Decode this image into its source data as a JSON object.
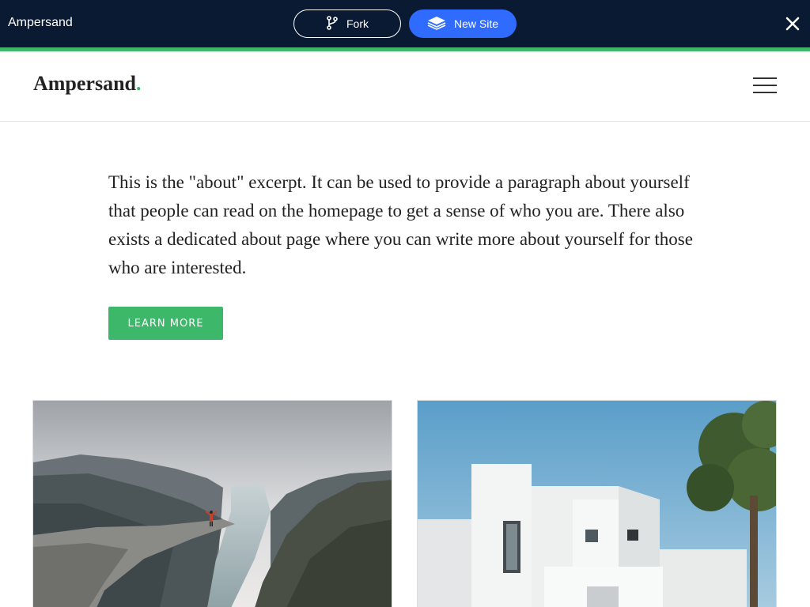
{
  "topbar": {
    "brand": "Ampersand",
    "fork_label": "Fork",
    "new_site_label": "New Site",
    "colors": {
      "background": "#0b1a33",
      "accent": "#3db86a",
      "primary": "#2f6bff"
    }
  },
  "header": {
    "logo": "Ampersand",
    "logo_dot": ".",
    "colors": {
      "dot": "#3db86a"
    }
  },
  "about": {
    "excerpt": "This is the \"about\" excerpt. It can be used to provide a paragraph about yourself that people can read on the homepage to get a sense of who you are. There also exists a dedicated about page where you can write more about yourself for those who are interested.",
    "button_label": "LEARN MORE",
    "colors": {
      "button": "#3db86a"
    }
  },
  "icons": {
    "fork": "fork-icon",
    "new_site": "layers-icon",
    "close": "close-icon",
    "menu": "hamburger-icon"
  }
}
